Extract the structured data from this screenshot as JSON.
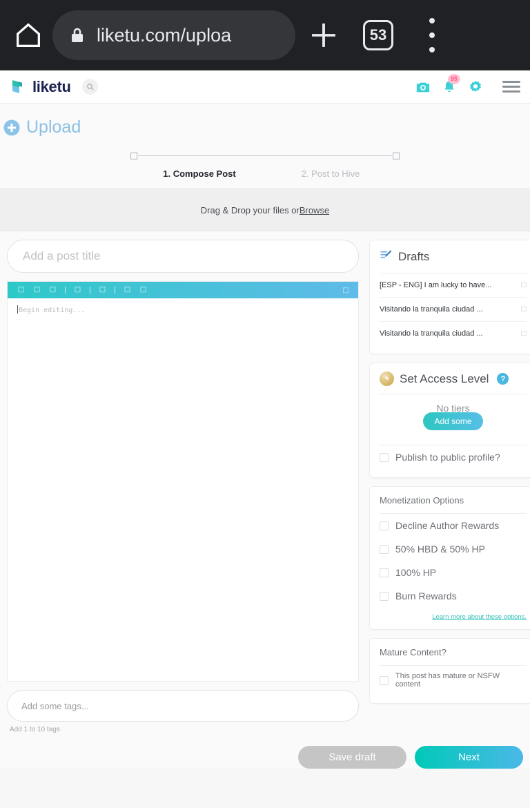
{
  "browser": {
    "url": "liketu.com/uploa",
    "tab_count": "53",
    "home_icon": "home-icon",
    "lock_icon": "lock-icon",
    "new_tab_icon": "plus-icon",
    "menu_icon": "kebab-menu-icon"
  },
  "site_nav": {
    "brand": "liketu",
    "search_icon": "search-icon",
    "camera_icon": "camera-icon",
    "bell_icon": "bell-icon",
    "notification_count": "95",
    "gear_icon": "gear-icon",
    "menu_icon": "hamburger-icon"
  },
  "page": {
    "title": "Upload",
    "add_icon": "plus-circle-icon"
  },
  "stepper": {
    "step1_marker": "□",
    "step2_marker": "□",
    "step1_label": "1. Compose Post",
    "step2_label": "2. Post to Hive"
  },
  "dropzone": {
    "text": "Drag & Drop your files or ",
    "browse_label": "Browse"
  },
  "composer": {
    "title_placeholder": "Add a post title",
    "title_value": "",
    "toolbar_items": [
      {
        "name": "bold-icon",
        "glyph": "□"
      },
      {
        "name": "italic-icon",
        "glyph": "□"
      },
      {
        "name": "heading-icon",
        "glyph": "□"
      },
      {
        "name": "link-icon",
        "glyph": "□"
      },
      {
        "name": "image-icon",
        "glyph": "□"
      },
      {
        "name": "list-ordered-icon",
        "glyph": "□"
      },
      {
        "name": "list-bullet-icon",
        "glyph": "□"
      }
    ],
    "toolbar_separator": "|",
    "toolbar_right_icon": {
      "name": "fullscreen-icon",
      "glyph": "□"
    },
    "body_placeholder": "Begin editing...",
    "tags_placeholder": "Add some tags...",
    "tags_value": "",
    "tags_hint": "Add 1 to 10 tags"
  },
  "drafts": {
    "icon": "drafts-edit-icon",
    "title": "Drafts",
    "items": [
      {
        "title": "[ESP - ENG] I am lucky to have...",
        "delete_glyph": "□"
      },
      {
        "title": "Visitando la tranquila ciudad ...",
        "delete_glyph": "□"
      },
      {
        "title": "Visitando la tranquila ciudad ...",
        "delete_glyph": "□"
      }
    ]
  },
  "access_level": {
    "icon": "coin-icon",
    "title": "Set Access Level",
    "help_glyph": "?",
    "no_tiers_label": "No tiers",
    "add_some_label": "Add some",
    "publish_public_label": "Publish to public profile?",
    "publish_public_checked": false
  },
  "monetization": {
    "title": "Monetization Options",
    "options": [
      {
        "label": "Decline Author Rewards",
        "checked": false
      },
      {
        "label": "50% HBD & 50% HP",
        "checked": false
      },
      {
        "label": "100% HP",
        "checked": false
      },
      {
        "label": "Burn Rewards",
        "checked": false
      }
    ],
    "learn_more_label": "Learn more about these options."
  },
  "mature": {
    "title": "Mature Content?",
    "checkbox_label": "This post has mature or NSFW content",
    "checked": false
  },
  "footer": {
    "save_draft_label": "Save draft",
    "next_label": "Next"
  },
  "colors": {
    "accent_teal": "#00c9b7",
    "accent_blue": "#4bb8e8",
    "brand_navy": "#1c2350",
    "badge_pink": "#ff5d8f",
    "upload_blue": "#8cc0e4",
    "link_teal": "#2fbfb8"
  }
}
